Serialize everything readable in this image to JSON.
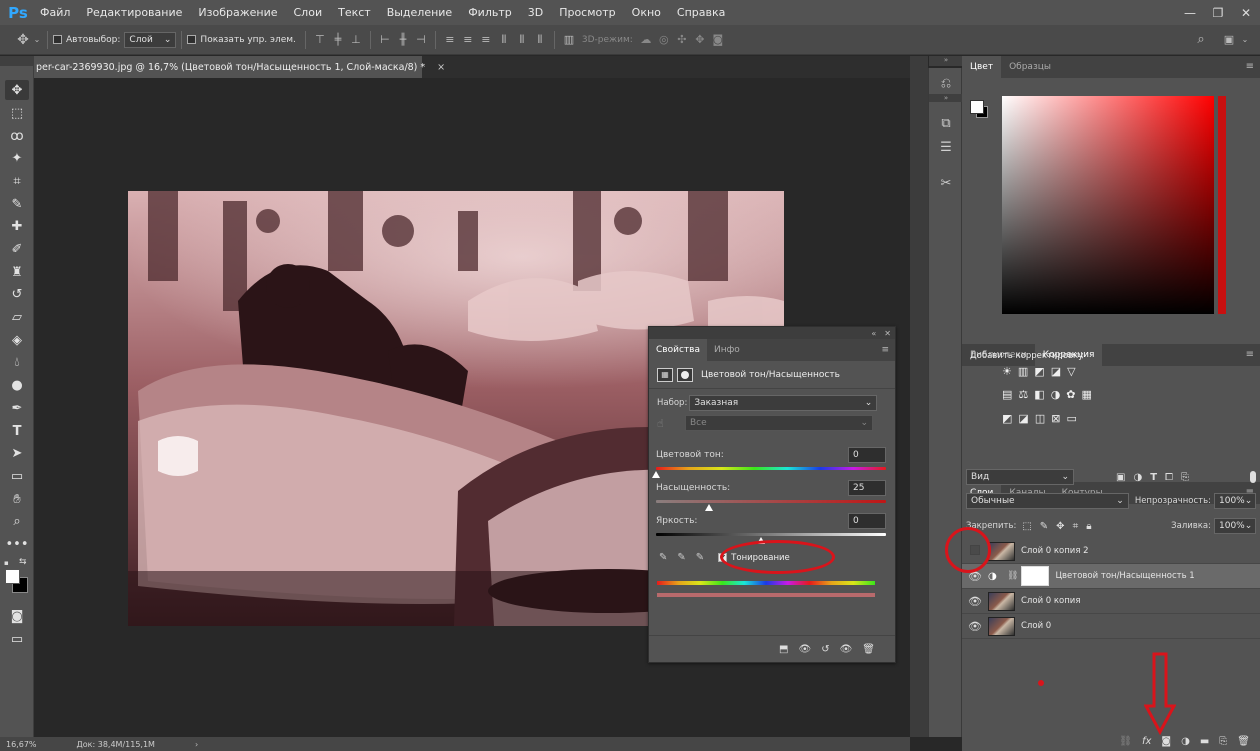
{
  "menubar": {
    "logo": "Ps",
    "items": [
      "Файл",
      "Редактирование",
      "Изображение",
      "Слои",
      "Текст",
      "Выделение",
      "Фильтр",
      "3D",
      "Просмотр",
      "Окно",
      "Справка"
    ]
  },
  "options": {
    "autoselect_label": "Автовыбор:",
    "autoselect_value": "Слой",
    "show_controls_label": "Показать упр. элем.",
    "mode3d_label": "3D-режим:"
  },
  "document": {
    "tab_title": "per-car-2369930.jpg @ 16,7% (Цветовой тон/Насыщенность 1, Слой-маска/8) *",
    "close": "×"
  },
  "properties": {
    "tabs": [
      "Свойства",
      "Инфо"
    ],
    "title": "Цветовой тон/Насыщенность",
    "preset_label": "Набор:",
    "preset_value": "Заказная",
    "channel_value": "Все",
    "hue_label": "Цветовой тон:",
    "hue_value": "0",
    "saturation_label": "Насыщенность:",
    "saturation_value": "25",
    "lightness_label": "Яркость:",
    "lightness_value": "0",
    "colorize_label": "Тонирование",
    "colorize_checked": true,
    "hue_range": [
      -180,
      180
    ],
    "saturation_range": [
      -100,
      100
    ],
    "lightness_range": [
      -100,
      100
    ]
  },
  "color_panel": {
    "tabs": [
      "Цвет",
      "Образцы"
    ],
    "hue_color": "#ff0000"
  },
  "adjustments_panel": {
    "tabs": [
      "Библиотеки",
      "Коррекция"
    ],
    "add_label": "Добавить корректировку"
  },
  "layers_panel": {
    "tabs": [
      "Слои",
      "Каналы",
      "Контуры"
    ],
    "filter_value": "Вид",
    "blend_mode": "Обычные",
    "opacity_label": "Непрозрачность:",
    "opacity_value": "100%",
    "lock_label": "Закрепить:",
    "fill_label": "Заливка:",
    "fill_value": "100%",
    "layers": [
      {
        "name": "Слой 0 копия 2",
        "visible": false,
        "type": "image"
      },
      {
        "name": "Цветовой тон/Насыщенность 1",
        "visible": true,
        "type": "adjustment"
      },
      {
        "name": "Слой 0 копия",
        "visible": true,
        "type": "image"
      },
      {
        "name": "Слой 0",
        "visible": true,
        "type": "image"
      }
    ],
    "bottom_icons": [
      "link-icon",
      "fx-icon",
      "mask-icon",
      "adjustment-icon",
      "folder-icon",
      "new-layer-icon",
      "trash-icon"
    ]
  },
  "statusbar": {
    "zoom": "16,67%",
    "doc_info": "Док: 38,4M/115,1M"
  },
  "annotation_color": "#d9141b"
}
